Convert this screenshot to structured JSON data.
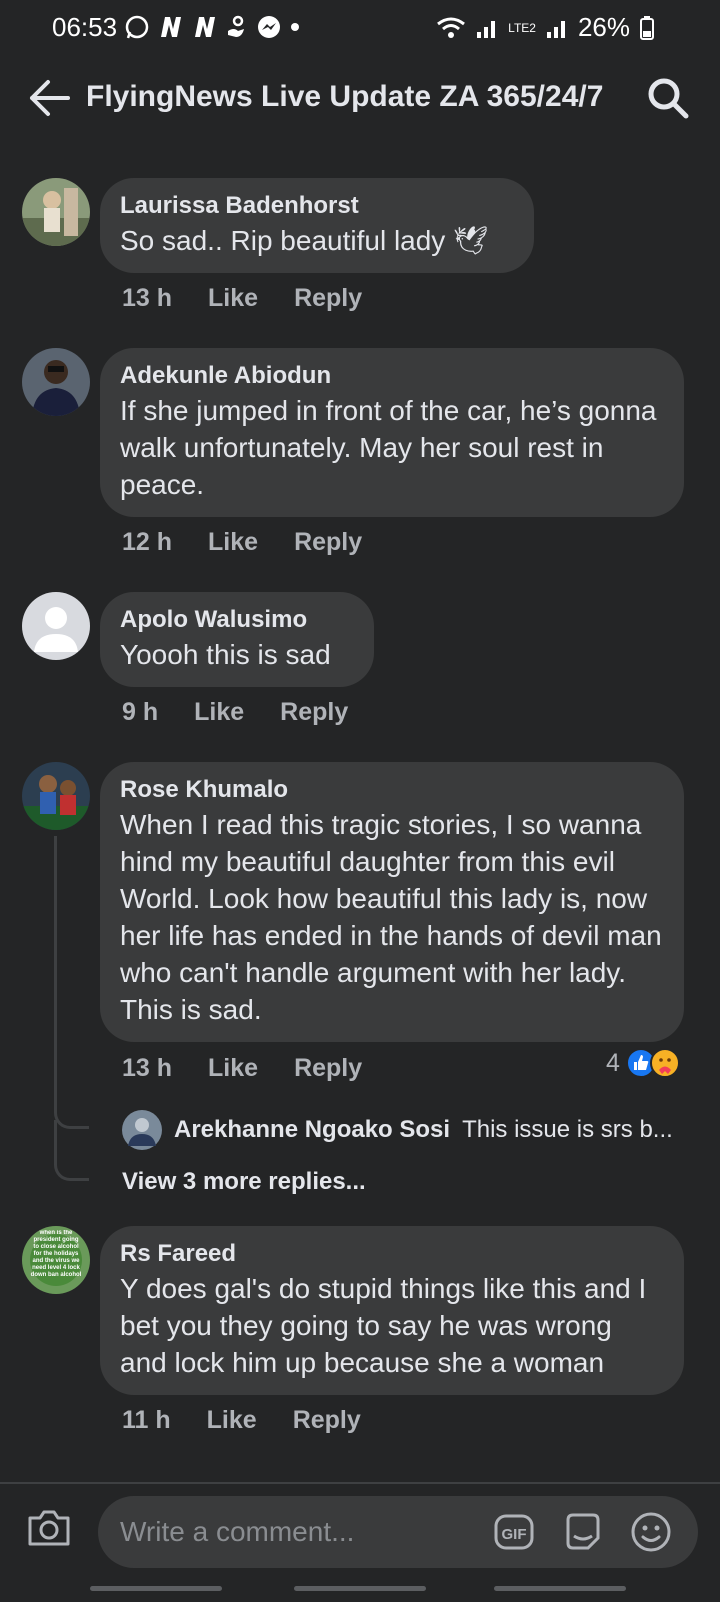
{
  "status": {
    "time": "06:53",
    "battery": "26%",
    "net_label": "LTE2"
  },
  "appbar": {
    "title": "FlyingNews Live Update ZA 365/24/7"
  },
  "comments": [
    {
      "author": "Laurissa Badenhorst",
      "text": "So sad.. Rip beautiful lady 🕊",
      "time": "13 h",
      "like": "Like",
      "reply": "Reply"
    },
    {
      "author": "Adekunle Abiodun",
      "text": "If she jumped in front of the car, he’s gonna walk unfortunately. May her soul rest in peace.",
      "time": "12 h",
      "like": "Like",
      "reply": "Reply"
    },
    {
      "author": "Apolo Walusimo",
      "text": "Yoooh this is sad",
      "time": "9 h",
      "like": "Like",
      "reply": "Reply"
    },
    {
      "author": "Rose Khumalo",
      "text": "When I read this tragic stories, I so wanna hind my beautiful daughter from this evil World. Look how beautiful this lady is, now her life has ended in the hands of devil man who can't handle argument with her lady. This is sad.",
      "time": "13 h",
      "like": "Like",
      "reply": "Reply",
      "reaction_count": "4"
    },
    {
      "author": "Rs Fareed",
      "text": "Y does gal's do stupid things like this and I bet you they going to say he was wrong and lock him up because she a woman",
      "time": "11 h",
      "like": "Like",
      "reply": "Reply"
    }
  ],
  "reply_preview": {
    "author": "Arekhanne Ngoako Sosi",
    "text": "This issue is srs b..."
  },
  "view_more": "View 3 more replies...",
  "avatar_text": "when is the president going to close alcohol for the holidays and the virus we need level 4 lock down ban alcohol",
  "composer": {
    "placeholder": "Write a comment..."
  },
  "colors": {
    "background": "#242526",
    "bubble": "#3a3b3c",
    "like_blue": "#1877f2",
    "secondary_text": "#b0b3b8"
  }
}
